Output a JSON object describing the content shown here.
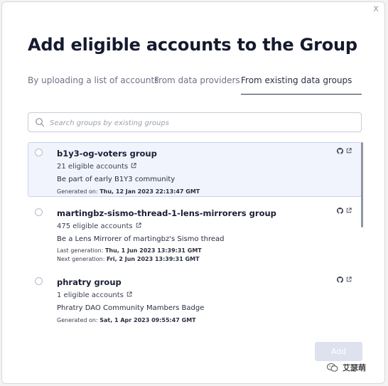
{
  "dialog": {
    "close_glyph": "x",
    "title": "Add eligible accounts to the Group"
  },
  "tabs": [
    {
      "label": "By uploading a list of accounts",
      "active": false
    },
    {
      "label": "From data providers",
      "active": false
    },
    {
      "label": "From existing data groups",
      "active": true
    }
  ],
  "search": {
    "placeholder": "Search groups by existing groups",
    "value": ""
  },
  "groups": [
    {
      "name": "b1y3-og-voters group",
      "eligible": "21 eligible accounts",
      "description": "Be part of early B1Y3 community",
      "generated_label": "Generated on:",
      "generated_value": "Thu, 12 Jan 2023 22:13:47 GMT",
      "selected": true
    },
    {
      "name": "martingbz-sismo-thread-1-lens-mirrorers group",
      "eligible": "475 eligible accounts",
      "description": "Be a Lens Mirrorer of martingbz's Sismo thread",
      "last_label": "Last generation:",
      "last_value": "Thu, 1 Jun 2023 13:39:31 GMT",
      "next_label": "Next generation:",
      "next_value": "Fri, 2 Jun 2023 13:39:31 GMT",
      "selected": false
    },
    {
      "name": "phratry group",
      "eligible": "1 eligible accounts",
      "description": "Phratry DAO Community Mambers Badge",
      "generated_label": "Generated on:",
      "generated_value": "Sat, 1 Apr 2023 09:55:47 GMT",
      "selected": false
    }
  ],
  "actions": {
    "add_label": "Add",
    "add_enabled": false
  },
  "watermark": {
    "text": "艾瑟萌"
  },
  "colors": {
    "title": "#141a2e",
    "selected_bg": "#f1f4fc",
    "selected_border": "#c8d4f4",
    "button_disabled": "#dde2ee"
  }
}
